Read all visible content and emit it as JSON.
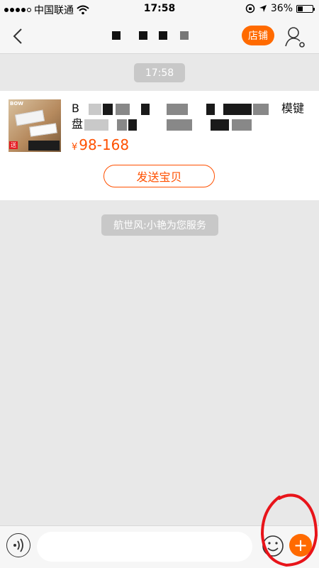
{
  "status_bar": {
    "carrier": "中国联通",
    "time": "17:58",
    "battery": "36%",
    "battery_level": 0.36
  },
  "nav": {
    "title": "▪ ▪ ▪ ...店",
    "store_button": "店铺",
    "icons": {
      "back": "back-chevron-icon",
      "profile": "person-settings-icon"
    }
  },
  "chat": {
    "timestamp": "17:58",
    "product": {
      "title_start": "B",
      "title_end": "模键",
      "title_line2_start": "盘",
      "price_currency": "¥",
      "price": "98-168",
      "send_button": "发送宝贝"
    },
    "service_message": "航世风:小艳为您服务"
  },
  "input_bar": {
    "placeholder": "",
    "icons": {
      "voice": "voice-icon",
      "emoji": "emoji-icon",
      "plus": "plus-icon"
    }
  },
  "colors": {
    "accent": "#ff6a00",
    "price": "#ff5000",
    "background": "#e8e8e8",
    "annotation": "#e8141a"
  }
}
